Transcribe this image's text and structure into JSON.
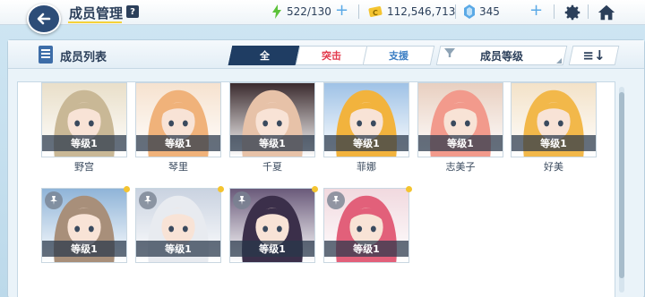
{
  "header": {
    "title": "成员管理",
    "help_label": "?",
    "stamina": "522/130",
    "credits": "112,546,713",
    "gems": "345",
    "plus_label": "+"
  },
  "panel": {
    "title": "成员列表",
    "tabs": [
      {
        "label": "全",
        "active": true
      },
      {
        "label": "突击",
        "active": false
      },
      {
        "label": "支援",
        "active": false
      }
    ],
    "sort_label": "成员等级",
    "order_label": "≡↓"
  },
  "colors": {
    "accent_navy": "#1f3d63",
    "tab_red": "#e2384a",
    "tab_blue": "#3d7fc4",
    "level_band": "#28374b",
    "stamina_green": "#5cc23a",
    "credits_yellow": "#f4c430",
    "gems_blue": "#5aa9e6"
  },
  "members_row1": [
    {
      "name": "野宫",
      "level": "等级1",
      "hair": "#c9b896",
      "bg": "#e9dfc9"
    },
    {
      "name": "琴里",
      "level": "等级1",
      "hair": "#f0b27a",
      "bg": "#f6e2cf"
    },
    {
      "name": "千夏",
      "level": "等级1",
      "hair": "#e7c2a8",
      "bg": "#3b2b2e"
    },
    {
      "name": "菲娜",
      "level": "等级1",
      "hair": "#f2b33d",
      "bg": "#9fc2e6"
    },
    {
      "name": "志美子",
      "level": "等级1",
      "hair": "#f29a8c",
      "bg": "#e8cfc0"
    },
    {
      "name": "好美",
      "level": "等级1",
      "hair": "#f2b84a",
      "bg": "#f3e2c8"
    }
  ],
  "members_row2": [
    {
      "name": "",
      "level": "等级1",
      "hair": "#a88f7a",
      "bg": "#8fb4d8"
    },
    {
      "name": "",
      "level": "等级1",
      "hair": "#e8ebf0",
      "bg": "#c9d2e0"
    },
    {
      "name": "",
      "level": "等级1",
      "hair": "#3b2f4a",
      "bg": "#6a5a7a"
    },
    {
      "name": "",
      "level": "等级1",
      "hair": "#e2607a",
      "bg": "#f1d9df"
    }
  ]
}
